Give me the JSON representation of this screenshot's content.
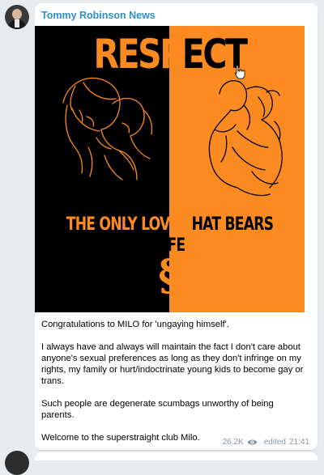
{
  "channel": {
    "sender_name": "Tommy Robinson News"
  },
  "post": {
    "image": {
      "headline_part1": "RESP",
      "headline_part2": "ECT",
      "tagline_part1": "THE ONLY LOVE T",
      "tagline_part2": "HAT BEARS LIFE",
      "symbol": "§",
      "colors": {
        "left_bg": "#000000",
        "right_bg": "#fb8b21"
      }
    },
    "caption": [
      "Congratulations to MILO for 'ungaying himself'.",
      "I always have and always will maintain the fact I don't care about anyone's sexual preferences as long as they don't infringe on my rights, my family or hurt/indoctrinate young kids to become gay or trans.",
      "Such people are degenerate scumbags unworthy of being parents.",
      "Welcome to the superstraight club Milo."
    ],
    "views": "26.2K",
    "edited_label": "edited",
    "time": "21:41"
  },
  "icons": [
    "eye-icon",
    "hand-cursor-icon"
  ]
}
